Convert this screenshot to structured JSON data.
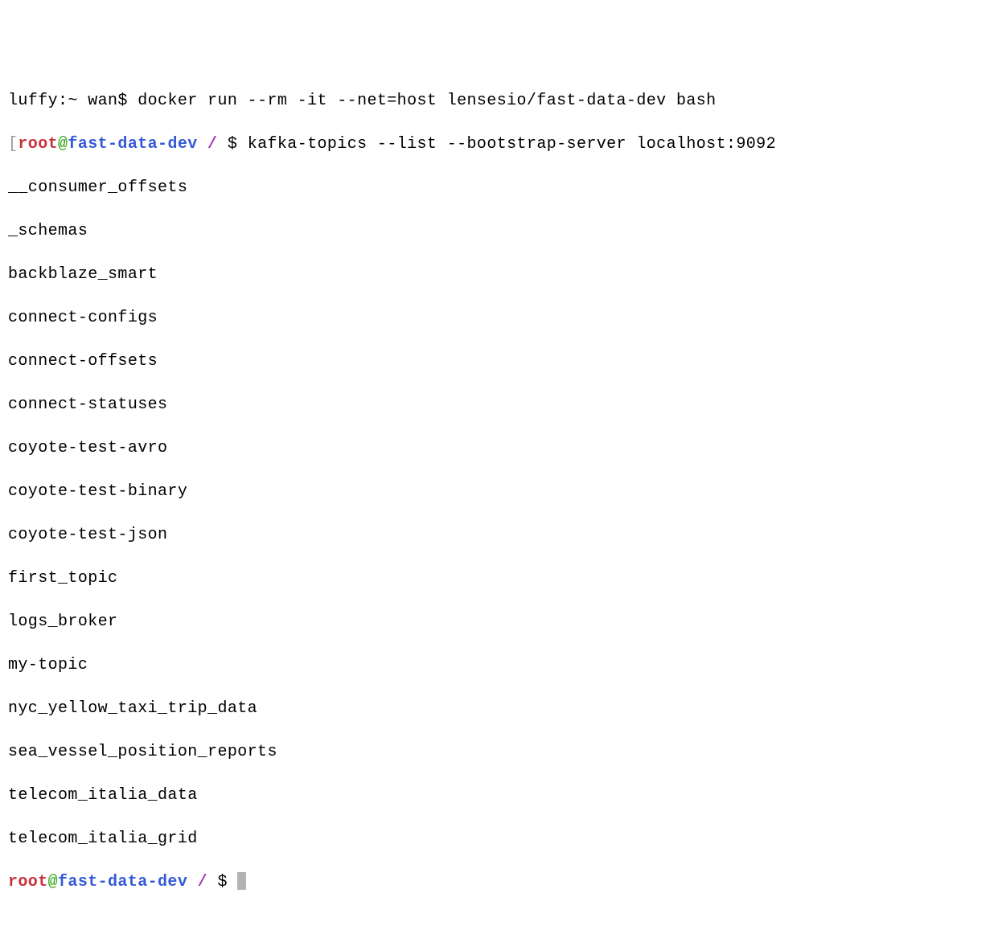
{
  "line1": {
    "prompt": "luffy:~ wan$ ",
    "command": "docker run --rm -it --net=host lensesio/fast-data-dev bash"
  },
  "prompt2": {
    "bracket": "[",
    "user": "root",
    "at": "@",
    "host": "fast-data-dev",
    "path": " / ",
    "dollar": "$ ",
    "command": "kafka-topics --list --bootstrap-server localhost:9092"
  },
  "topics": [
    "__consumer_offsets",
    "_schemas",
    "backblaze_smart",
    "connect-configs",
    "connect-offsets",
    "connect-statuses",
    "coyote-test-avro",
    "coyote-test-binary",
    "coyote-test-json",
    "first_topic",
    "logs_broker",
    "my-topic",
    "nyc_yellow_taxi_trip_data",
    "sea_vessel_position_reports",
    "telecom_italia_data",
    "telecom_italia_grid"
  ],
  "prompt3": {
    "user": "root",
    "at": "@",
    "host": "fast-data-dev",
    "path": " / ",
    "dollar": "$ "
  }
}
